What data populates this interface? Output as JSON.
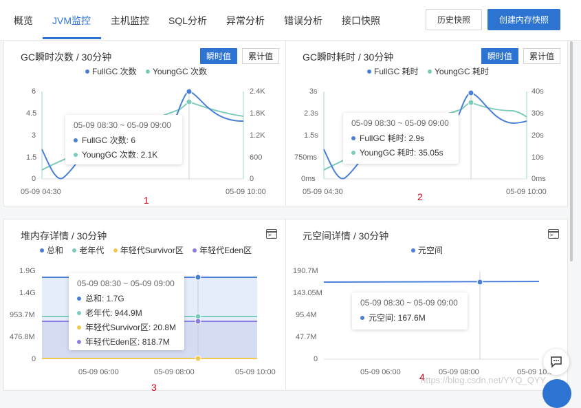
{
  "tabs": [
    {
      "label": "概览"
    },
    {
      "label": "JVM监控"
    },
    {
      "label": "主机监控"
    },
    {
      "label": "SQL分析"
    },
    {
      "label": "异常分析"
    },
    {
      "label": "错误分析"
    },
    {
      "label": "接口快照"
    }
  ],
  "actions": {
    "history": "历史快照",
    "create": "创建内存快照"
  },
  "colors": {
    "accent": "#2d74d2",
    "fullgc": "#4a7fd6",
    "younggc": "#7ccbbb",
    "old": "#7ccbbb",
    "survivor": "#f2c94c",
    "eden": "#8c7ee0",
    "metaspace": "#4a7fd6"
  },
  "panels": {
    "p1": {
      "title": "GC瞬时次数 / 30分钟",
      "seg_instant": "瞬时值",
      "seg_cumulative": "累计值",
      "legend": [
        "FullGC 次数",
        "YoungGC 次数"
      ],
      "y_left": [
        "6",
        "4.5",
        "3",
        "1.5",
        "0"
      ],
      "y_right": [
        "2.4K",
        "1.8K",
        "1.2K",
        "600",
        "0"
      ],
      "x": [
        "05-09 04:30",
        "05-09 10:00"
      ],
      "tooltip": {
        "time": "05-09 08:30 ~ 05-09 09:00",
        "rows": [
          "FullGC 次数:  6",
          "YoungGC 次数:  2.1K"
        ]
      },
      "num": "1"
    },
    "p2": {
      "title": "GC瞬时耗时 / 30分钟",
      "seg_instant": "瞬时值",
      "seg_cumulative": "累计值",
      "legend": [
        "FullGC 耗时",
        "YoungGC 耗时"
      ],
      "y_left": [
        "3s",
        "2.3s",
        "1.5s",
        "750ms",
        "0ms"
      ],
      "y_right": [
        "40s",
        "30s",
        "20s",
        "10s",
        "0ms"
      ],
      "x": [
        "05-09 04:30",
        "05-09 10:00"
      ],
      "tooltip": {
        "time": "05-09 08:30 ~ 05-09 09:00",
        "rows": [
          "FullGC 耗时:  2.9s",
          "YoungGC 耗时:  35.05s"
        ]
      },
      "num": "2"
    },
    "p3": {
      "title": "堆内存详情 / 30分钟",
      "legend": [
        "总和",
        "老年代",
        "年轻代Survivor区",
        "年轻代Eden区"
      ],
      "y": [
        "1.9G",
        "1.4G",
        "953.7M",
        "476.8M",
        "0"
      ],
      "x": [
        "05-09 06:00",
        "05-09 08:00",
        "05-09 10:00"
      ],
      "tooltip": {
        "time": "05-09 08:30 ~ 05-09 09:00",
        "rows": [
          "总和:  1.7G",
          "老年代:  944.9M",
          "年轻代Survivor区:  20.8M",
          "年轻代Eden区:  818.7M"
        ]
      },
      "num": "3"
    },
    "p4": {
      "title": "元空间详情 / 30分钟",
      "legend": [
        "元空间"
      ],
      "y": [
        "190.7M",
        "143.05M",
        "95.4M",
        "47.7M",
        "0"
      ],
      "x": [
        "05-09 06:00",
        "05-09 08:00",
        "05-09 10:00"
      ],
      "tooltip": {
        "time": "05-09 08:30 ~ 05-09 09:00",
        "rows": [
          "元空间:  167.6M"
        ]
      },
      "num": "4"
    }
  },
  "watermark": "https://blog.csdn.net/YYQ_QYY"
}
